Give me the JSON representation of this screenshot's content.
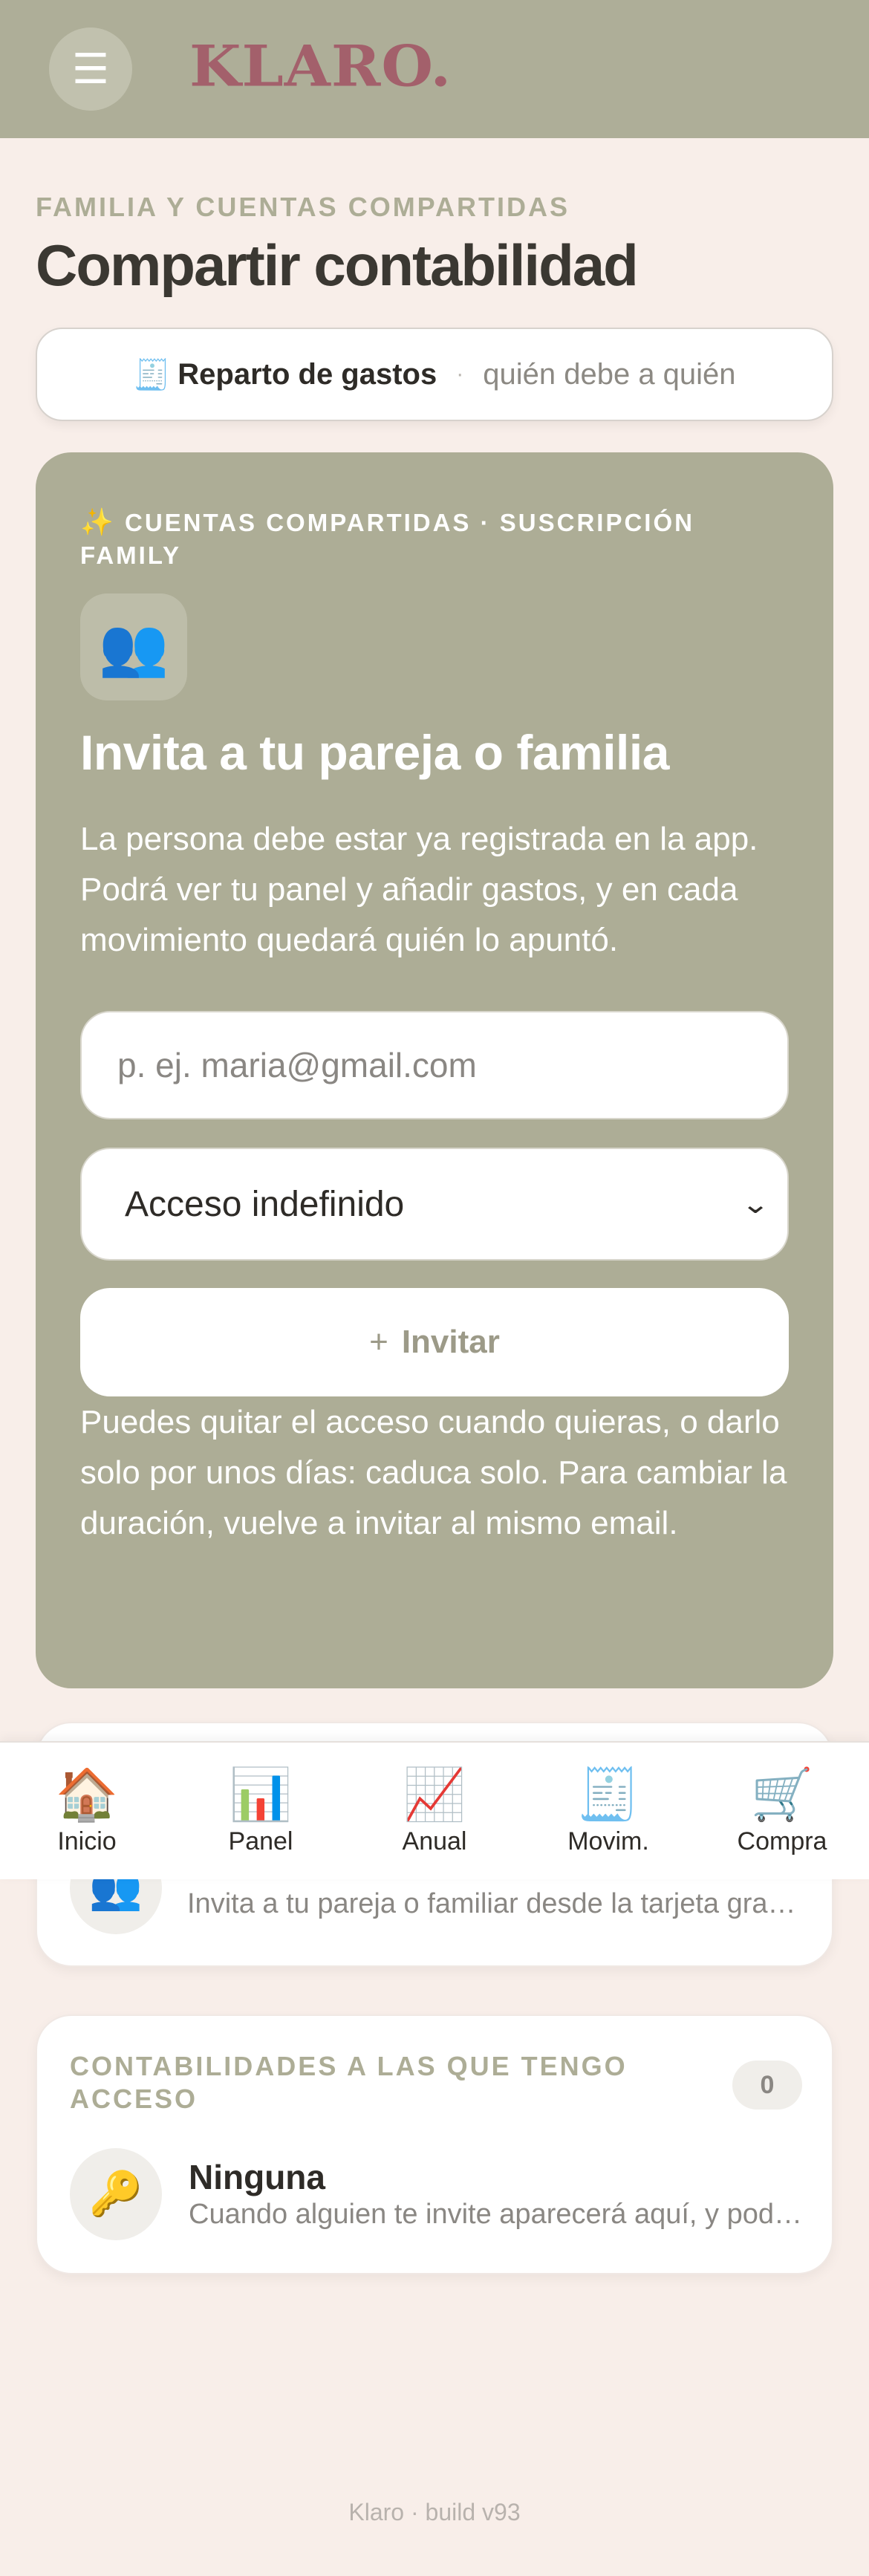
{
  "app": {
    "logo": "KLARO.",
    "menu_icon": "hamburger-icon"
  },
  "header": {
    "kicker": "FAMILIA Y CUENTAS COMPARTIDAS",
    "title": "Compartir contabilidad"
  },
  "segments": {
    "active_icon": "🧾",
    "active_label": "Reparto de gastos",
    "separator": "·",
    "inactive_label": "quién debe a quién"
  },
  "invite_card": {
    "kicker_icon": "✨",
    "kicker": "CUENTAS COMPARTIDAS · SUSCRIPCIÓN FAMILY",
    "avatar": "👥",
    "heading": "Invita a tu pareja o familia",
    "description": "La persona debe estar ya registrada en la app. Podrá ver tu panel y añadir gastos, y en cada movimiento quedará quién lo apuntó.",
    "email_placeholder": "p. ej. maria@gmail.com",
    "email_value": "",
    "access_selected": "Acceso indefinido",
    "invite_plus": "+",
    "invite_label": "Invitar",
    "help": "Puedes quitar el acceso cuando quieras, o darlo solo por unos días: caduca solo. Para cambiar la duración, vuelve a invitar al mismo email."
  },
  "members_card": {
    "avatar": "👥",
    "subtitle": "Invita a tu pareja o familiar desde la tarjeta grande de arriba."
  },
  "access_card": {
    "kicker": "CONTABILIDADES A LAS QUE TENGO ACCESO",
    "count": "0",
    "avatar": "🔑",
    "title": "Ninguna",
    "subtitle": "Cuando alguien te invite aparecerá aquí, y podrás entrar en su contabilidad."
  },
  "nav": [
    {
      "icon": "🏠",
      "label": "Inicio"
    },
    {
      "icon": "📊",
      "label": "Panel"
    },
    {
      "icon": "📈",
      "label": "Anual"
    },
    {
      "icon": "🧾",
      "label": "Movim."
    },
    {
      "icon": "🛒",
      "label": "Compra"
    }
  ],
  "footer": "Klaro · build v93"
}
